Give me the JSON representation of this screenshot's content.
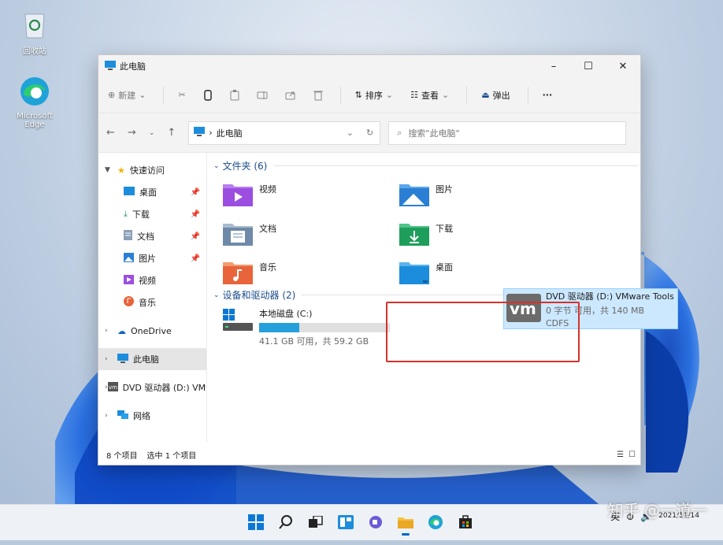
{
  "desktop": {
    "icons": [
      {
        "label": "回收站",
        "icon": "recycle-bin-icon"
      },
      {
        "label": "Microsoft Edge",
        "icon": "edge-icon"
      }
    ]
  },
  "window": {
    "title": "此电脑",
    "controls": {
      "minimize": "–",
      "maximize": "☐",
      "close": "✕"
    }
  },
  "commandbar": {
    "new_label": "新建",
    "sort_label": "排序",
    "view_label": "查看",
    "eject_label": "弹出",
    "more_label": "···"
  },
  "address": {
    "crumb": "此电脑",
    "search_placeholder": "搜索\"此电脑\""
  },
  "sidebar": {
    "quick_access": "快速访问",
    "quick_items": [
      {
        "label": "桌面",
        "pinned": true
      },
      {
        "label": "下载",
        "pinned": true
      },
      {
        "label": "文档",
        "pinned": true
      },
      {
        "label": "图片",
        "pinned": true
      },
      {
        "label": "视频",
        "pinned": false
      },
      {
        "label": "音乐",
        "pinned": false
      }
    ],
    "onedrive": "OneDrive",
    "this_pc": "此电脑",
    "dvd": "DVD 驱动器 (D:) VMware Tools",
    "network": "网络"
  },
  "content": {
    "folders_header": "文件夹 (6)",
    "folders": [
      {
        "label": "视频",
        "color": "#9b4ee0"
      },
      {
        "label": "图片",
        "color": "#2a7fd4"
      },
      {
        "label": "文档",
        "color": "#6e8aa8"
      },
      {
        "label": "下载",
        "color": "#1e9e5a"
      },
      {
        "label": "音乐",
        "color": "#e8643a"
      },
      {
        "label": "桌面",
        "color": "#1c8ddc"
      }
    ],
    "drives_header": "设备和驱动器 (2)",
    "local_disk": {
      "name": "本地磁盘 (C:)",
      "free": "41.1 GB 可用，共 59.2 GB",
      "used_fraction": 0.31
    },
    "dvd": {
      "name": "DVD 驱动器 (D:) VMware Tools",
      "space": "0 字节 可用，共 140 MB",
      "fs": "CDFS",
      "logo": "vm"
    }
  },
  "status": {
    "items": "8 个项目",
    "selected": "选中 1 个项目"
  },
  "taskbar": {
    "lang": "英",
    "date": "2021/11/14"
  },
  "watermark": "知乎 @一道一"
}
